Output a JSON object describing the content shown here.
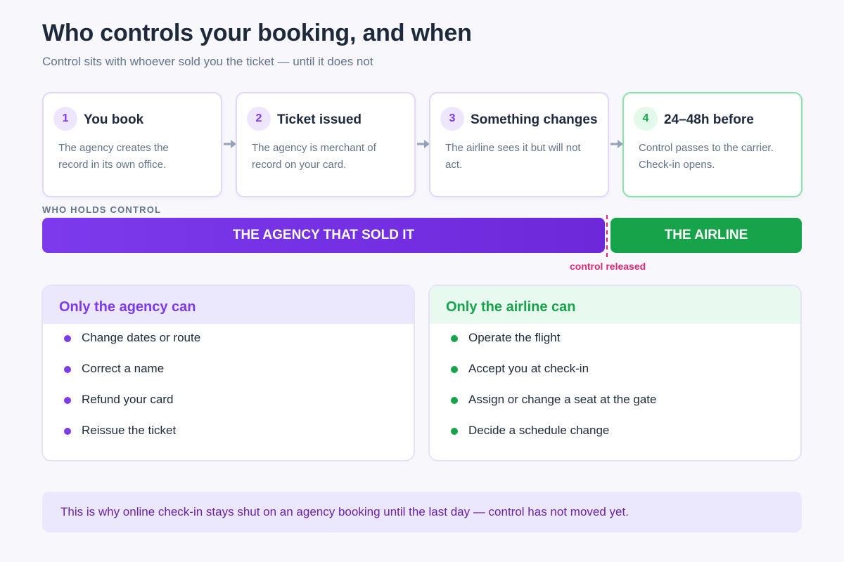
{
  "header": {
    "title": "Who controls your booking, and when",
    "subtitle": "Control sits with whoever sold you the ticket — until it does not"
  },
  "steps": [
    {
      "num": "1",
      "title": "You book",
      "desc": "The agency creates the record in its own office."
    },
    {
      "num": "2",
      "title": "Ticket issued",
      "desc": "The agency is merchant of record on your card."
    },
    {
      "num": "3",
      "title": "Something changes",
      "desc": "The airline sees it but will not act."
    },
    {
      "num": "4",
      "title": "24–48h before",
      "desc": "Control passes to the carrier. Check-in opens."
    }
  ],
  "control": {
    "label": "WHO HOLDS CONTROL",
    "agency": "THE AGENCY THAT SOLD IT",
    "airline": "THE AIRLINE",
    "release": "control released"
  },
  "panels": {
    "agency": {
      "title": "Only the agency can",
      "items": [
        "Change dates or route",
        "Correct a name",
        "Refund your card",
        "Reissue the ticket"
      ]
    },
    "airline": {
      "title": "Only the airline can",
      "items": [
        "Operate the flight",
        "Accept you at check-in",
        "Assign or change a seat at the gate",
        "Decide a schedule change"
      ]
    }
  },
  "note": "This is why online check-in stays shut on an agency booking until the last day — control has not moved yet.",
  "colors": {
    "agency": "#7c3aed",
    "airline": "#16a34a",
    "release": "#db2777"
  }
}
